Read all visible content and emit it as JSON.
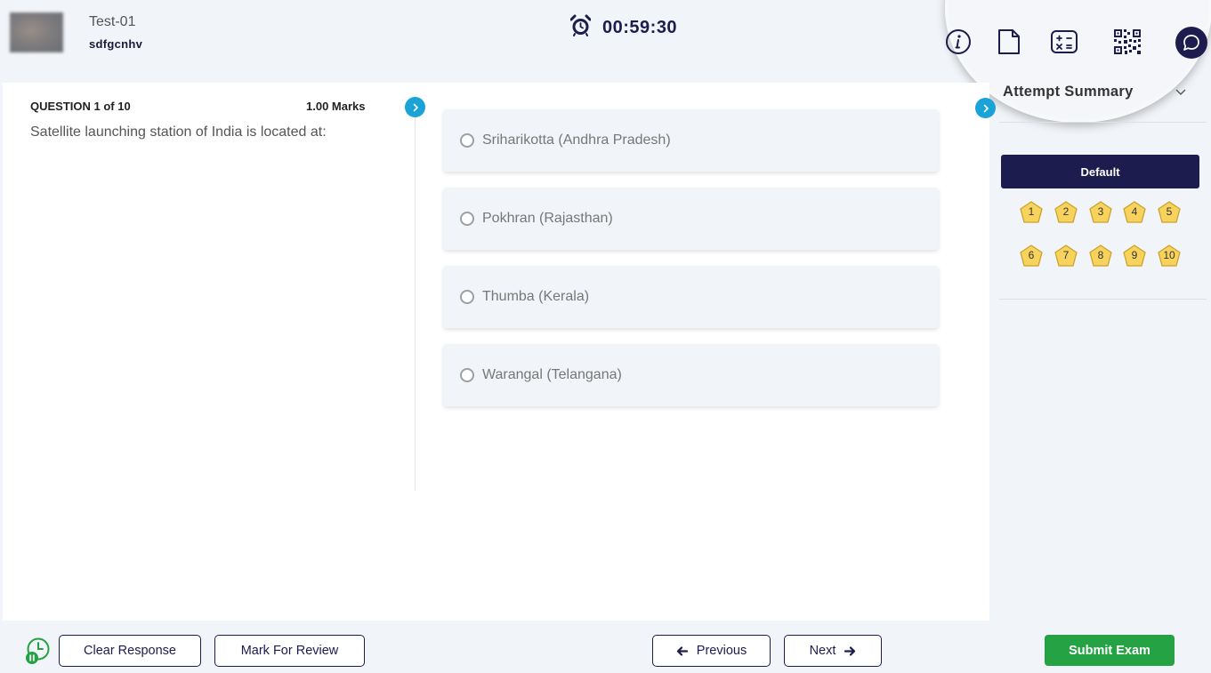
{
  "header": {
    "test_name": "Test-01",
    "user_name": "sdfgcnhv",
    "timer": "00:59:30"
  },
  "toolbar": {
    "icons": [
      "info-icon",
      "document-icon",
      "calculator-icon",
      "qr-code-icon",
      "chat-icon"
    ],
    "summary_title": "Attempt Summary"
  },
  "question": {
    "label": "QUESTION 1 of 10",
    "marks": "1.00 Marks",
    "text": "Satellite launching station of India is located at:",
    "options": [
      "Sriharikotta (Andhra Pradesh)",
      "Pokhran (Rajasthan)",
      "Thumba (Kerala)",
      "Warangal (Telangana)"
    ]
  },
  "palette": {
    "section": "Default",
    "numbers": [
      "1",
      "2",
      "3",
      "4",
      "5",
      "6",
      "7",
      "8",
      "9",
      "10"
    ],
    "badge_color": "#f7d25c",
    "badge_border": "#c9a32a"
  },
  "footer": {
    "clear": "Clear Response",
    "review": "Mark For Review",
    "previous": "Previous",
    "next": "Next",
    "submit": "Submit Exam"
  },
  "colors": {
    "navy": "#1c1c4e",
    "accent_blue": "#1aa3d6",
    "submit_green": "#25a244"
  }
}
